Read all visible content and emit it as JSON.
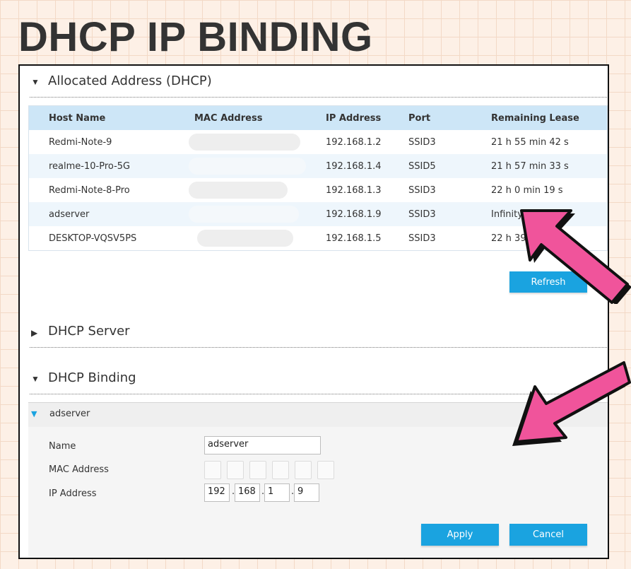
{
  "page_title": "DHCP IP BINDING",
  "allocated": {
    "section_label": "Allocated Address (DHCP)",
    "columns": [
      "Host Name",
      "MAC Address",
      "IP Address",
      "Port",
      "Remaining Lease"
    ],
    "rows": [
      {
        "host": "Redmi-Note-9",
        "ip": "192.168.1.2",
        "port": "SSID3",
        "lease": "21 h 55 min 42 s"
      },
      {
        "host": "realme-10-Pro-5G",
        "ip": "192.168.1.4",
        "port": "SSID5",
        "lease": "21 h 57 min 33 s"
      },
      {
        "host": "Redmi-Note-8-Pro",
        "ip": "192.168.1.3",
        "port": "SSID3",
        "lease": "22 h 0 min 19 s"
      },
      {
        "host": "adserver",
        "ip": "192.168.1.9",
        "port": "SSID3",
        "lease": "Infinity"
      },
      {
        "host": "DESKTOP-VQSV5PS",
        "ip": "192.168.1.5",
        "port": "SSID3",
        "lease": "22 h 39 m"
      }
    ],
    "refresh_label": "Refresh"
  },
  "dhcp_server": {
    "section_label": "DHCP Server"
  },
  "dhcp_binding": {
    "section_label": "DHCP Binding",
    "entry_label": "adserver",
    "name_label": "Name",
    "name_value": "adserver",
    "mac_label": "MAC Address",
    "ip_label": "IP Address",
    "ip_octets": [
      "192",
      "168",
      "1",
      "9"
    ],
    "apply_label": "Apply",
    "cancel_label": "Cancel"
  },
  "colors": {
    "accent": "#1aa3e0",
    "header_row": "#cde6f7",
    "arrow_pink": "#f0549b",
    "title": "#333333"
  },
  "icons": [
    "triangle-down-icon",
    "triangle-right-icon",
    "pink-arrow-icon"
  ]
}
